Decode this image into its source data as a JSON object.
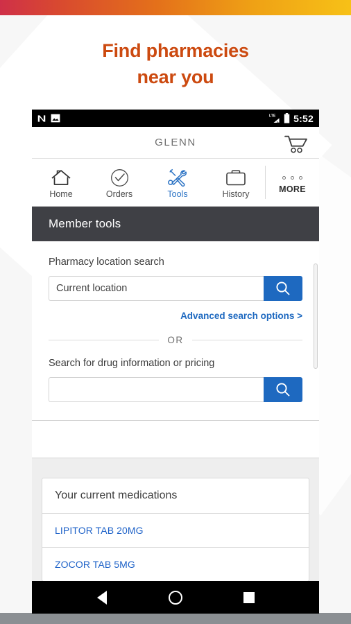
{
  "promo": {
    "heading_line1": "Find pharmacies",
    "heading_line2": "near you",
    "accent_color": "#cc4a10",
    "gradient_from": "#cf3048",
    "gradient_to": "#f7c117"
  },
  "statusbar": {
    "icons": [
      "nova-launcher-icon",
      "screenshot-image-icon"
    ],
    "network": "LTE",
    "battery": "battery-icon",
    "time": "5:52"
  },
  "titlebar": {
    "app_title": "GLENN",
    "cart_icon": "shopping-cart-icon"
  },
  "navtabs": [
    {
      "label": "Home",
      "icon": "house-icon",
      "active": false
    },
    {
      "label": "Orders",
      "icon": "check-circle-icon",
      "active": false
    },
    {
      "label": "Tools",
      "icon": "tools-wrench-screwdriver-icon",
      "active": true
    },
    {
      "label": "History",
      "icon": "briefcase-icon",
      "active": false
    },
    {
      "label": "MORE",
      "icon": "three-dots-icon",
      "active": false
    }
  ],
  "section": {
    "header_title": "Member tools"
  },
  "pharmacy_search": {
    "label": "Pharmacy location search",
    "value": "Current location",
    "placeholder": "Current location",
    "search_icon": "magnifier-icon",
    "button_color": "#1e69c0",
    "advanced_link": "Advanced search options  >"
  },
  "divider": {
    "text": "OR"
  },
  "drug_search": {
    "label": "Search for drug information or pricing",
    "value": "",
    "placeholder": "",
    "search_icon": "magnifier-icon"
  },
  "medications": {
    "title": "Your current medications",
    "items": [
      {
        "name": "LIPITOR TAB 20MG"
      },
      {
        "name": "ZOCOR TAB 5MG"
      }
    ],
    "link_color": "#1e62c8"
  },
  "androidnav": {
    "back": "back-triangle-icon",
    "home": "home-circle-icon",
    "recent": "recent-apps-square-icon"
  }
}
